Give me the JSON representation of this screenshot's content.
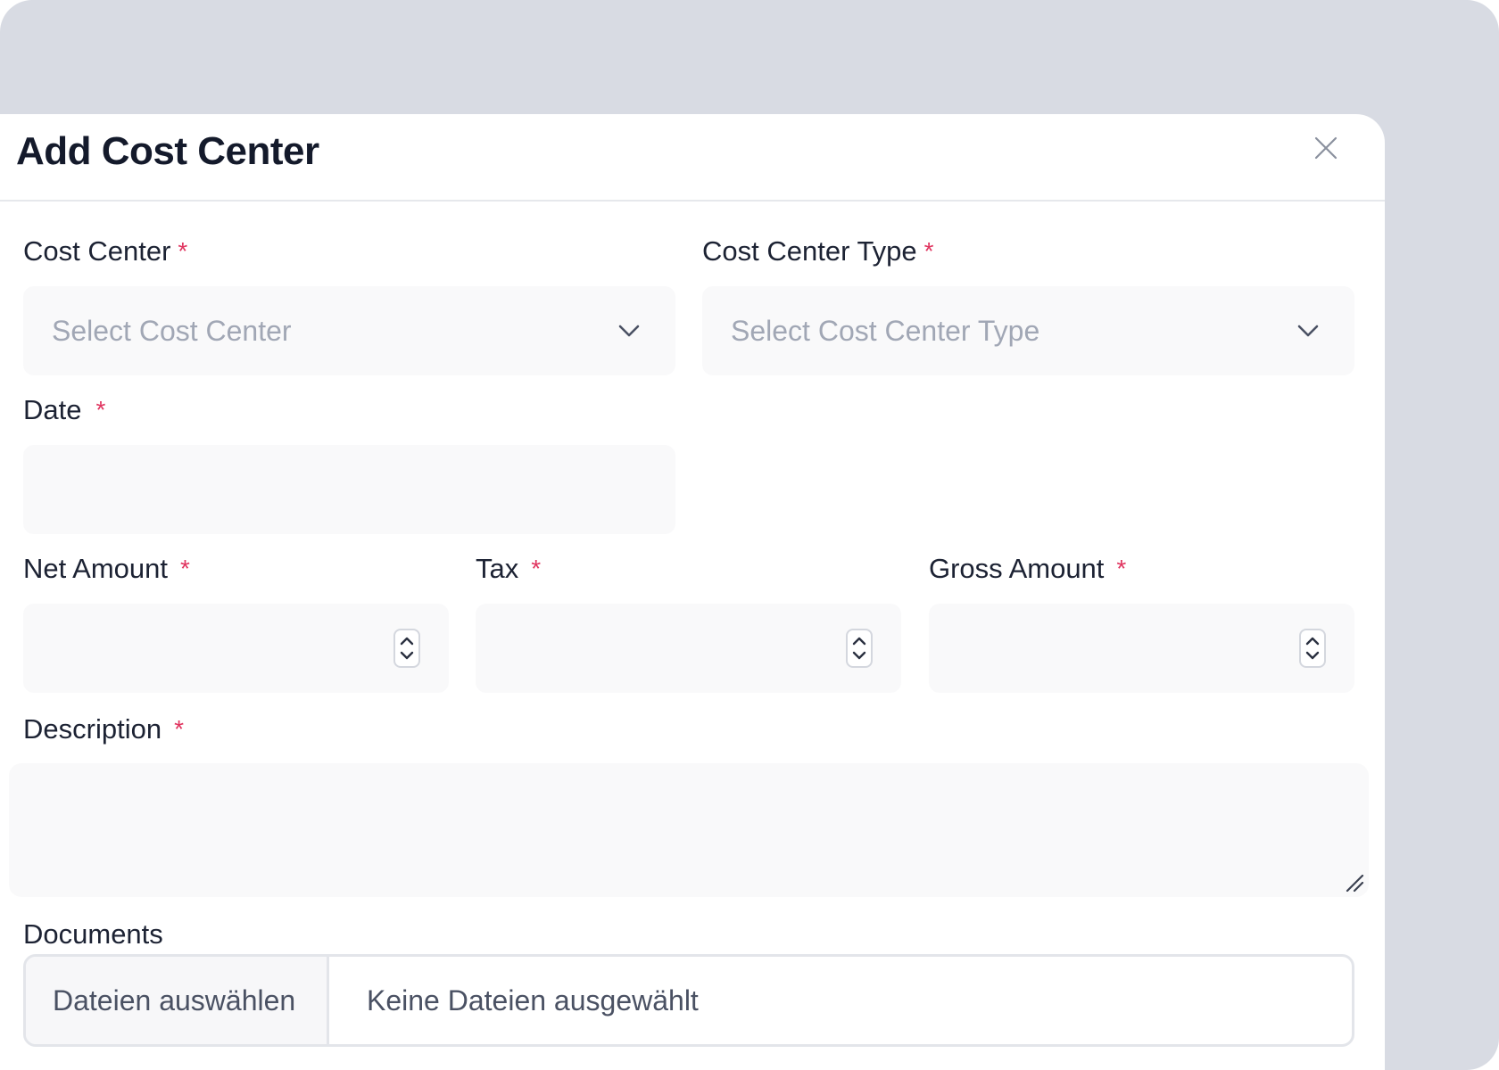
{
  "modal": {
    "title": "Add Cost Center",
    "close_icon": "close-icon"
  },
  "form": {
    "cost_center": {
      "label": "Cost Center",
      "required_mark": "*",
      "placeholder": "Select Cost Center",
      "icon": "chevron-down-icon"
    },
    "cost_center_type": {
      "label": "Cost Center Type",
      "required_mark": "*",
      "placeholder": "Select Cost Center Type",
      "icon": "chevron-down-icon"
    },
    "date": {
      "label": "Date",
      "required_mark": "*",
      "value": ""
    },
    "net_amount": {
      "label": "Net Amount",
      "required_mark": "*",
      "value": ""
    },
    "tax": {
      "label": "Tax",
      "required_mark": "*",
      "value": ""
    },
    "gross_amount": {
      "label": "Gross Amount",
      "required_mark": "*",
      "value": ""
    },
    "description": {
      "label": "Description",
      "required_mark": "*",
      "value": ""
    },
    "documents": {
      "label": "Documents",
      "button_label": "Dateien auswählen",
      "status": "Keine Dateien ausgewählt"
    }
  },
  "colors": {
    "backdrop": "#d8dbe3",
    "required": "#e0345f",
    "input_bg": "#f9f9fa",
    "title": "#141a2b"
  }
}
